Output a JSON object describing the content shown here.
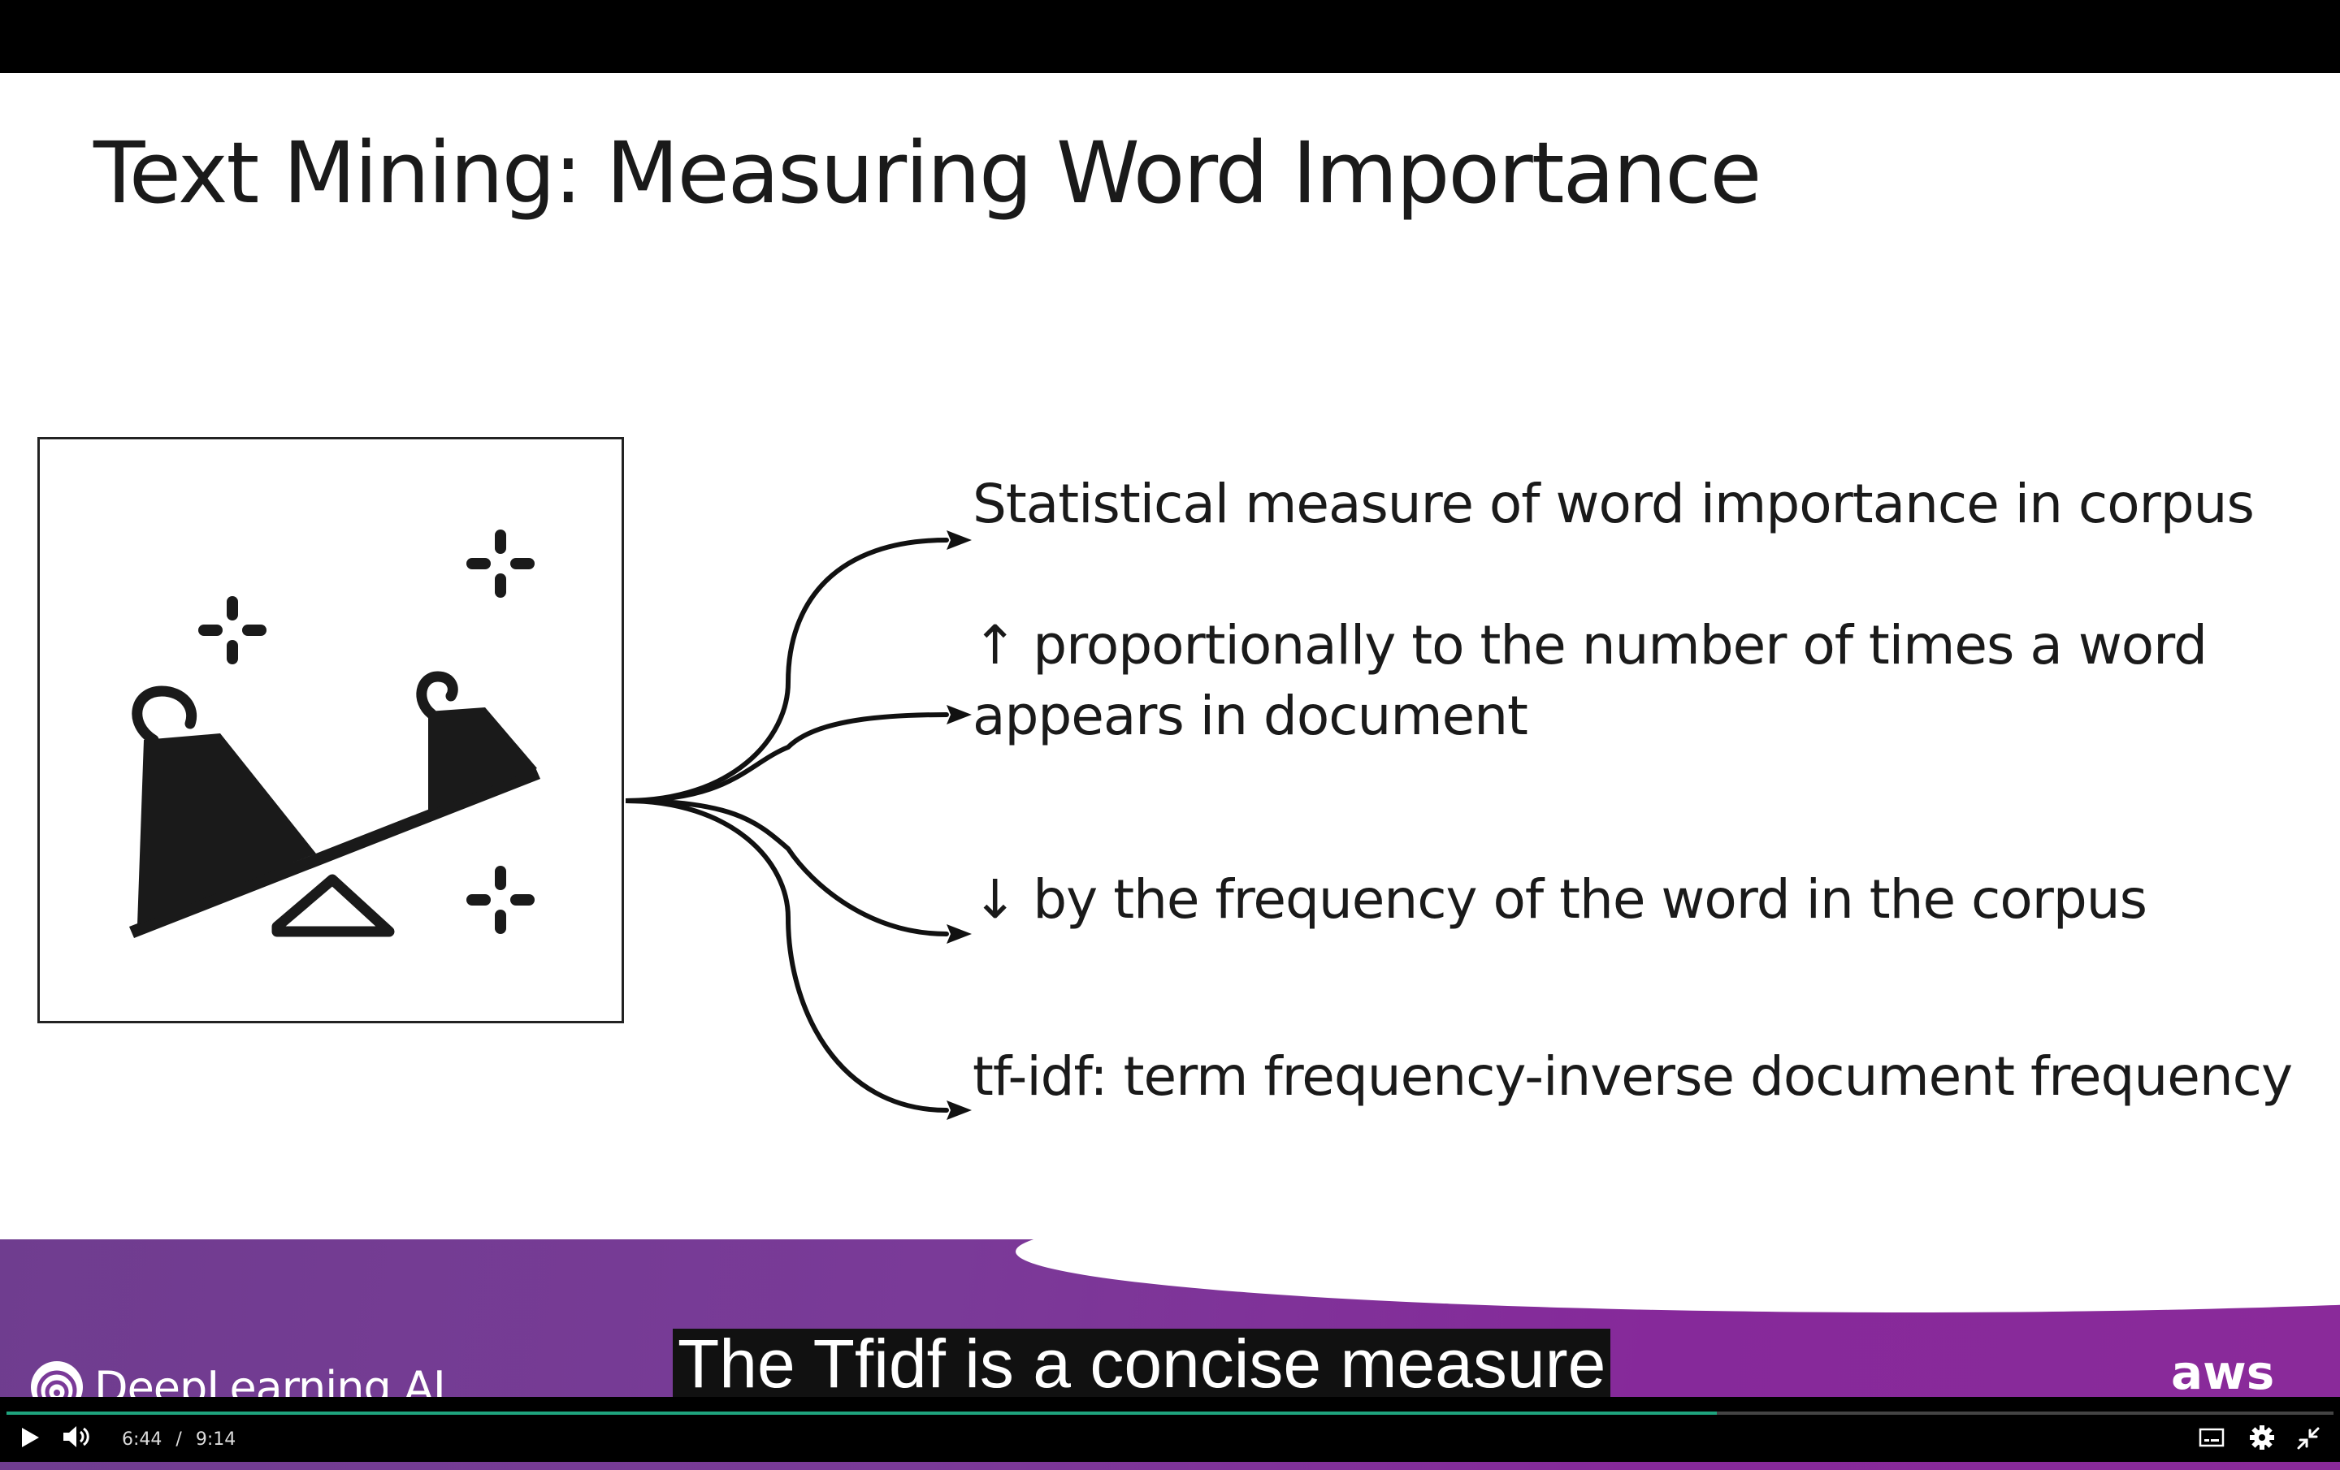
{
  "slide": {
    "title": "Text Mining: Measuring Word Importance",
    "bullets": [
      {
        "text": "Statistical measure of word importance in corpus"
      },
      {
        "line1": "↑ proportionally to the number of times a word",
        "line2": "appears in document"
      },
      {
        "text": "↓ by the frequency of the word in the corpus"
      },
      {
        "text": "tf-idf: term frequency-inverse document frequency"
      }
    ],
    "illustration_icon": "balance-scale-icon"
  },
  "footer": {
    "brand": "DeepLearning.AI",
    "partner": "aws",
    "colors": {
      "gradient_start": "#6f3d8f",
      "gradient_end": "#8a2a9a"
    }
  },
  "caption": "The Tfidf is a concise measure",
  "player": {
    "current_time": "6:44",
    "separator": "/",
    "duration": "9:14",
    "progress_fraction": 0.735,
    "accent": "#1fa47e"
  }
}
